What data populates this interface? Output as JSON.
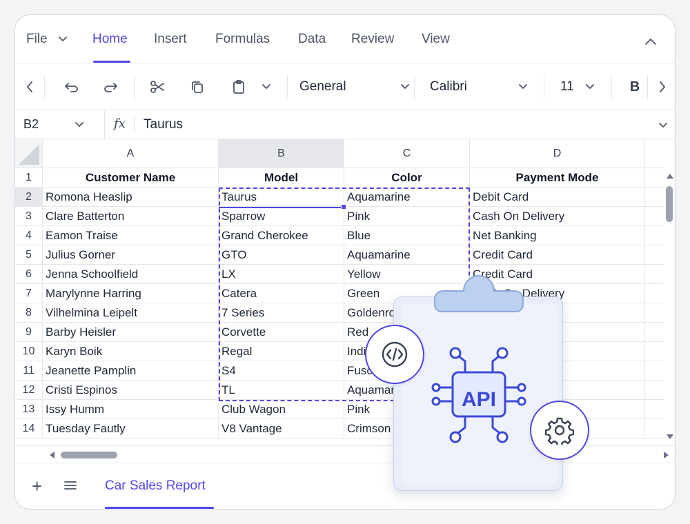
{
  "menu": {
    "file": "File",
    "tabs": [
      "Home",
      "Insert",
      "Formulas",
      "Data",
      "Review",
      "View"
    ],
    "active_tab": "Home"
  },
  "toolbar": {
    "number_format": "General",
    "font_family": "Calibri",
    "font_size": "11",
    "bold_label": "B"
  },
  "formula_bar": {
    "name_box": "B2",
    "fx_label": "fx",
    "value": "Taurus"
  },
  "grid": {
    "columns": [
      "A",
      "B",
      "C",
      "D"
    ],
    "selected_column": "B",
    "selected_row": "2",
    "rows": [
      {
        "num": "1",
        "cells": [
          "Customer Name",
          "Model",
          "Color",
          "Payment Mode"
        ]
      },
      {
        "num": "2",
        "cells": [
          "Romona Heaslip",
          "Taurus",
          "Aquamarine",
          "Debit Card"
        ]
      },
      {
        "num": "3",
        "cells": [
          "Clare Batterton",
          "Sparrow",
          "Pink",
          "Cash On Delivery"
        ]
      },
      {
        "num": "4",
        "cells": [
          "Eamon Traise",
          "Grand Cherokee",
          "Blue",
          "Net Banking"
        ]
      },
      {
        "num": "5",
        "cells": [
          "Julius Gorner",
          "GTO",
          "Aquamarine",
          "Credit Card"
        ]
      },
      {
        "num": "6",
        "cells": [
          "Jenna Schoolfield",
          "LX",
          "Yellow",
          "Credit Card"
        ]
      },
      {
        "num": "7",
        "cells": [
          "Marylynne Harring",
          "Catera",
          "Green",
          "Cash On Delivery"
        ]
      },
      {
        "num": "8",
        "cells": [
          "Vilhelmina Leipelt",
          "7 Series",
          "Goldenrod",
          ""
        ]
      },
      {
        "num": "9",
        "cells": [
          "Barby Heisler",
          "Corvette",
          "Red",
          ""
        ]
      },
      {
        "num": "10",
        "cells": [
          "Karyn Boik",
          "Regal",
          "Indigo",
          ""
        ]
      },
      {
        "num": "11",
        "cells": [
          "Jeanette Pamplin",
          "S4",
          "Fuscia",
          ""
        ]
      },
      {
        "num": "12",
        "cells": [
          "Cristi Espinos",
          "TL",
          "Aquamarine",
          ""
        ]
      },
      {
        "num": "13",
        "cells": [
          "Issy Humm",
          "Club Wagon",
          "Pink",
          ""
        ]
      },
      {
        "num": "14",
        "cells": [
          "Tuesday Fautly",
          "V8 Vantage",
          "Crimson",
          ""
        ]
      }
    ]
  },
  "sheets": {
    "active": "Car Sales Report"
  },
  "illustration": {
    "badge_text": "API",
    "icons": [
      "clipboard-icon",
      "code-icon",
      "api-chip-icon",
      "gear-icon"
    ]
  },
  "colors": {
    "accent": "#4f46e5",
    "selection_header": "#e5e7eb",
    "api_blue": "#3b48d6"
  }
}
